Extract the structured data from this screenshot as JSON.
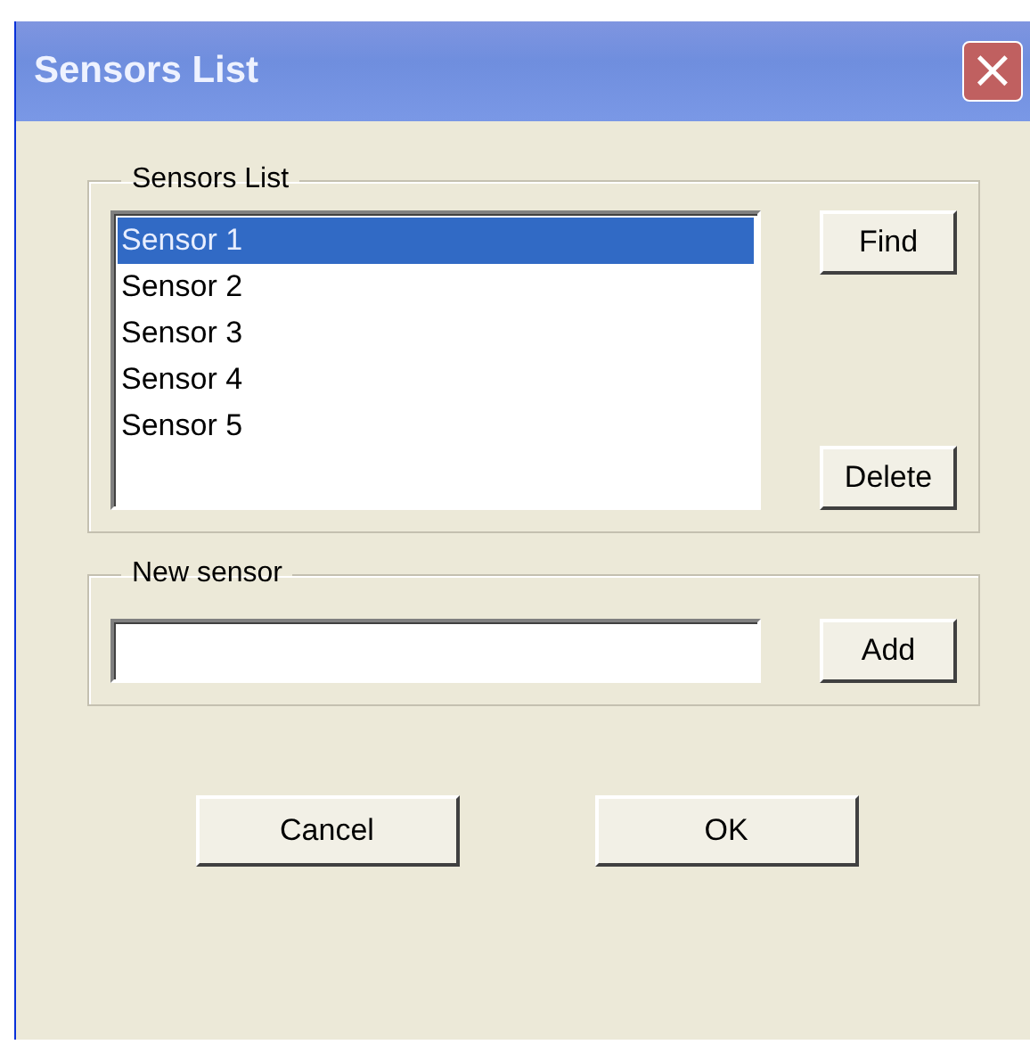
{
  "window": {
    "title": "Sensors List",
    "close": "×"
  },
  "sensors_group": {
    "legend": "Sensors List",
    "items": [
      {
        "label": "Sensor 1",
        "selected": true
      },
      {
        "label": "Sensor 2",
        "selected": false
      },
      {
        "label": "Sensor 3",
        "selected": false
      },
      {
        "label": "Sensor 4",
        "selected": false
      },
      {
        "label": "Sensor 5",
        "selected": false
      }
    ],
    "find_button": "Find",
    "delete_button": "Delete"
  },
  "new_sensor_group": {
    "legend": "New sensor",
    "add_button": "Add"
  },
  "buttons": [
    "Cancel",
    "OK"
  ]
}
